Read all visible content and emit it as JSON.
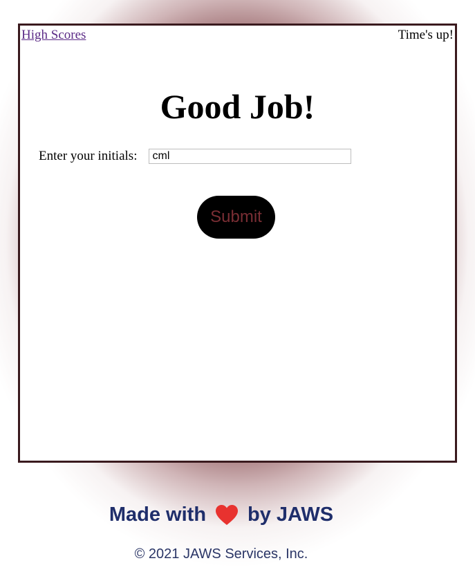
{
  "header": {
    "high_scores_link": "High Scores",
    "timer_text": "Time's up!"
  },
  "main": {
    "title": "Good Job!",
    "initials_label": "Enter your initials:",
    "initials_value": "cml",
    "submit_label": "Submit"
  },
  "footer": {
    "made_with_prefix": "Made with",
    "heart_icon": "heart-icon",
    "made_with_suffix": "by JAWS",
    "copyright": "© 2021 JAWS Services, Inc."
  },
  "colors": {
    "card_border": "#3a1a1e",
    "glow": "#6e282d",
    "button_bg": "#000000",
    "button_text": "#7a2e34",
    "footer_text": "#1f2e6b",
    "heart": "#e8322f",
    "link": "#5b2a86"
  }
}
